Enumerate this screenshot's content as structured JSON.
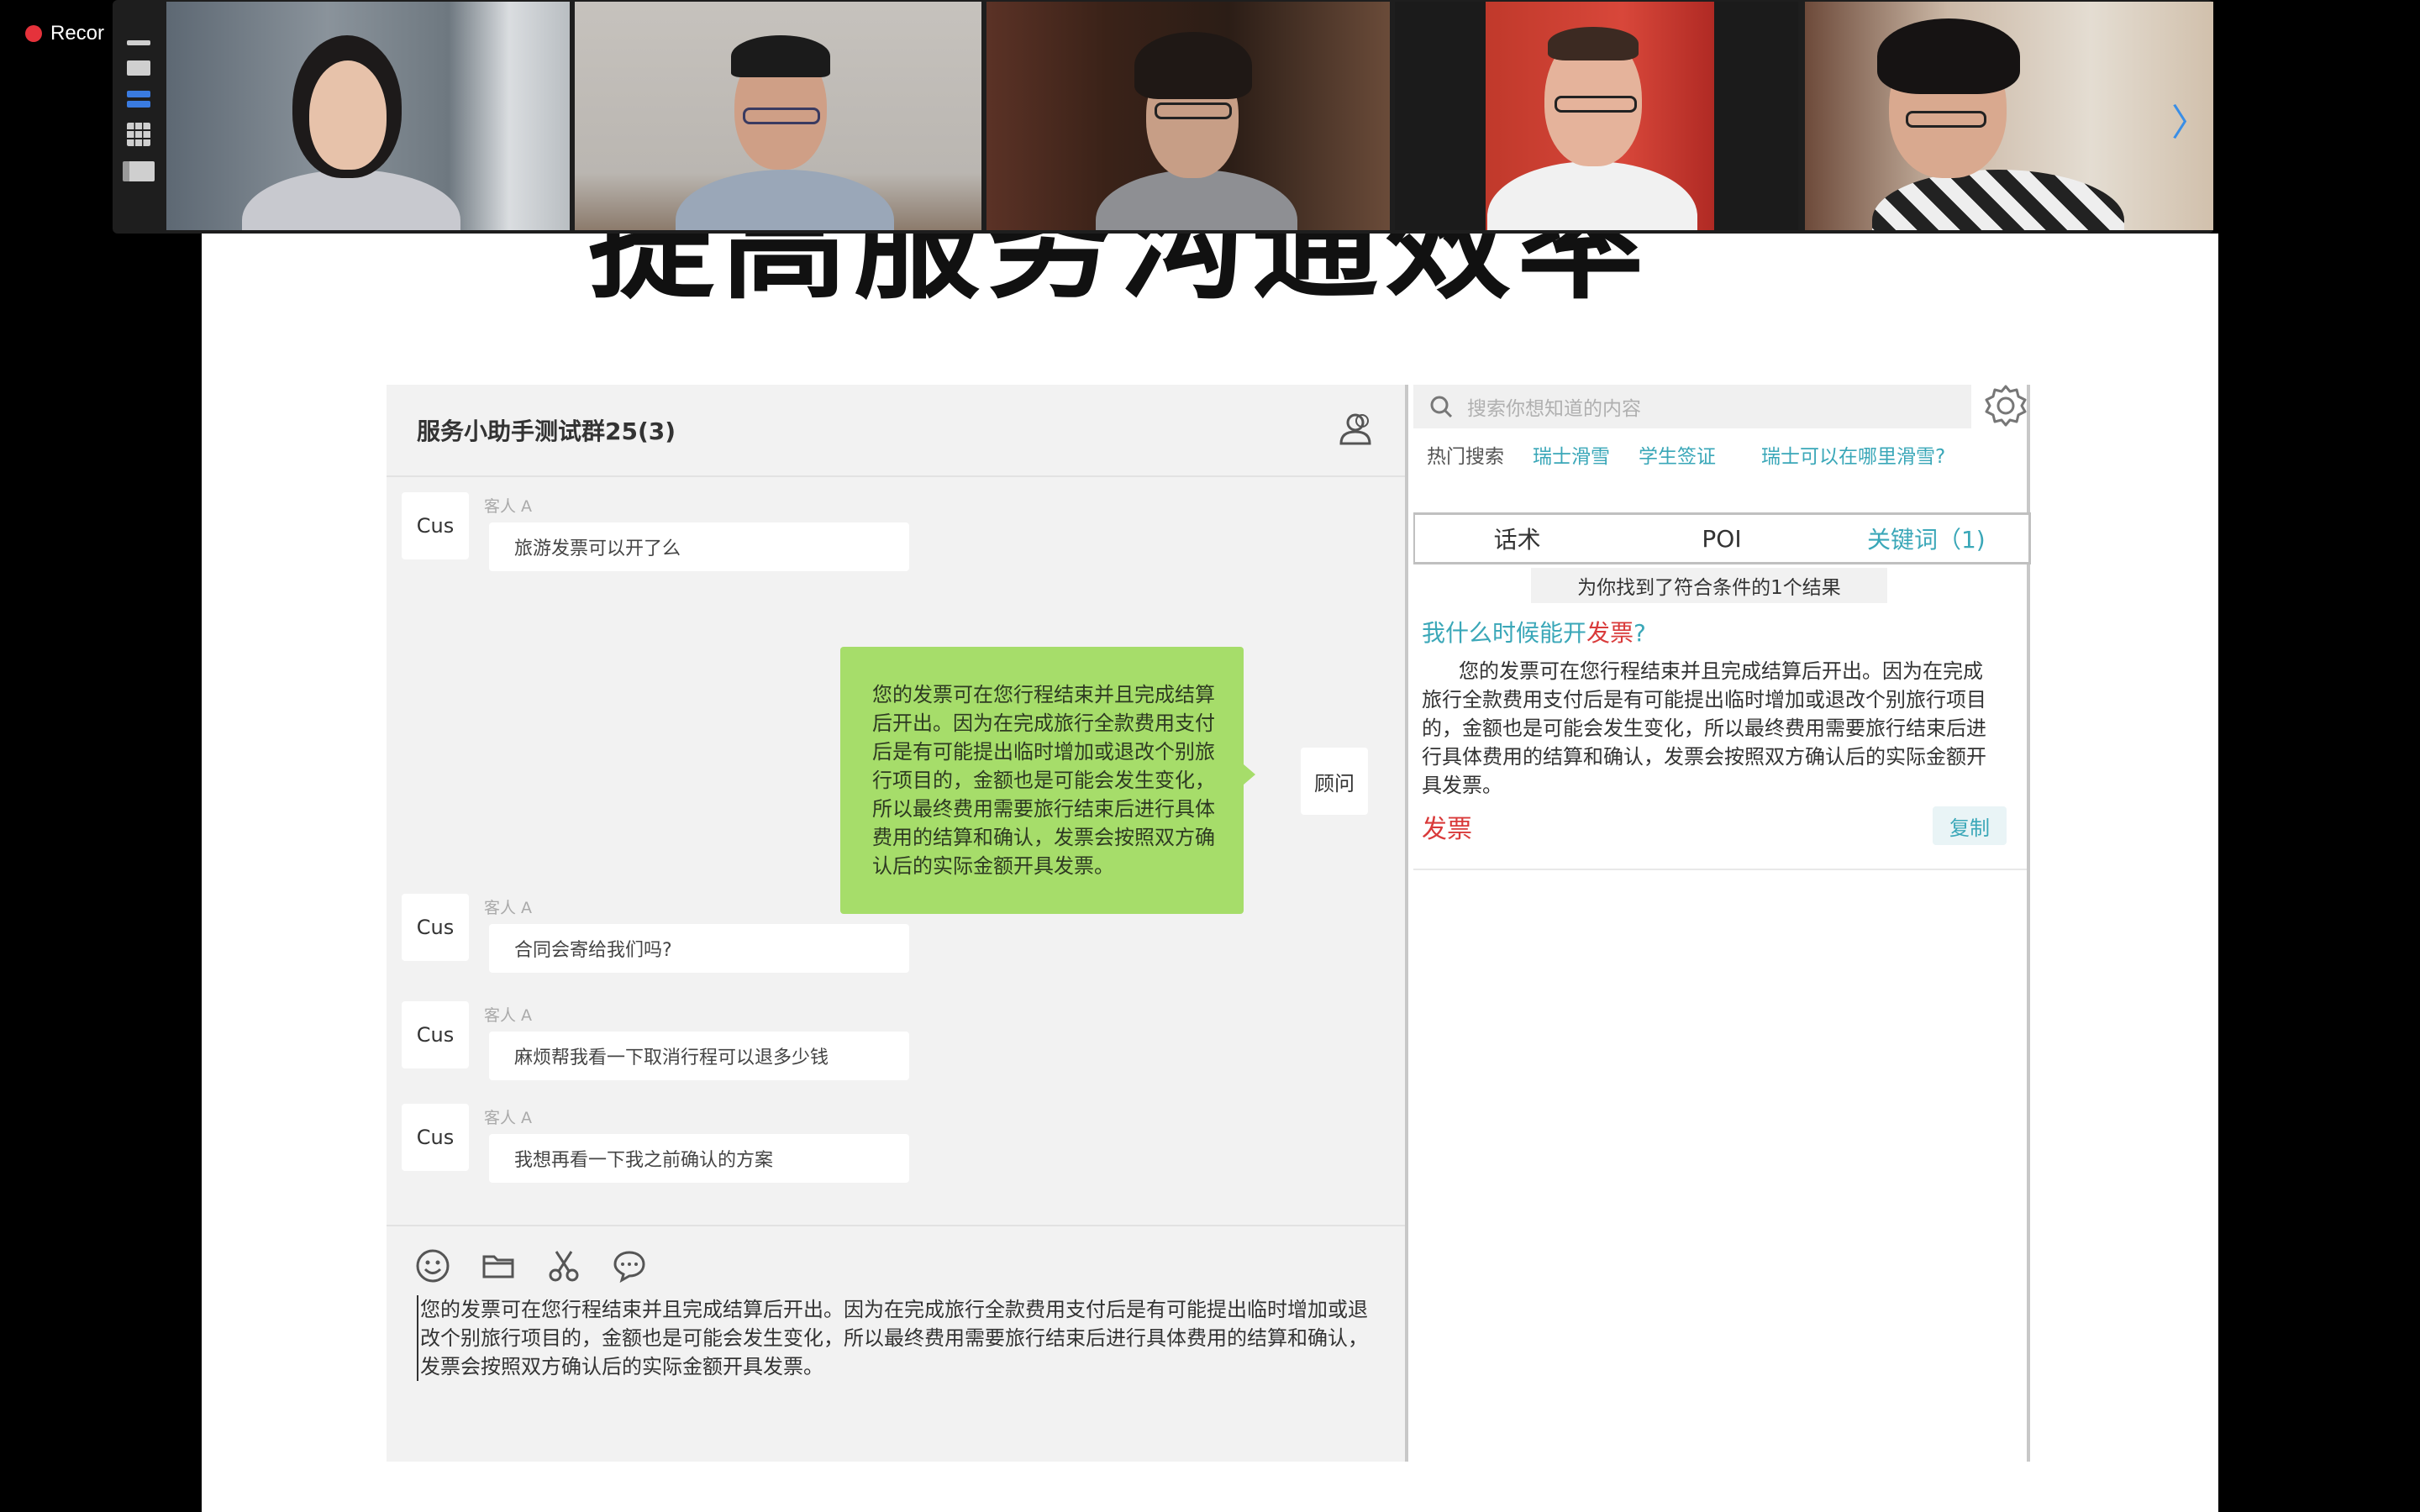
{
  "recording": {
    "label": "Recor"
  },
  "gallery": {
    "participants": [
      {
        "name": "participant-1"
      },
      {
        "name": "participant-2",
        "speaking": true
      },
      {
        "name": "participant-3"
      },
      {
        "name": "participant-4"
      },
      {
        "name": "participant-5"
      }
    ],
    "next_icon": "chevron-right-icon"
  },
  "slide": {
    "title": "提高服务沟通效率"
  },
  "chat": {
    "title": "服务小助手测试群25(3)",
    "messages": [
      {
        "avatar": "Cus",
        "sender": "客人 A",
        "text": "旅游发票可以开了么"
      },
      {
        "avatar": "顾问",
        "text": "您的发票可在您行程结束并且完成结算后开出。因为在完成旅行全款费用支付后是有可能提出临时增加或退改个别旅行项目的，金额也是可能会发生变化，所以最终费用需要旅行结束后进行具体费用的结算和确认，发票会按照双方确认后的实际金额开具发票。"
      },
      {
        "avatar": "Cus",
        "sender": "客人 A",
        "text": "合同会寄给我们吗?"
      },
      {
        "avatar": "Cus",
        "sender": "客人 A",
        "text": "麻烦帮我看一下取消行程可以退多少钱"
      },
      {
        "avatar": "Cus",
        "sender": "客人 A",
        "text": "我想再看一下我之前确认的方案"
      }
    ],
    "composer_text": "您的发票可在您行程结束并且完成结算后开出。因为在完成旅行全款费用支付后是有可能提出临时增加或退改个别旅行项目的，金额也是可能会发生变化，所以最终费用需要旅行结束后进行具体费用的结算和确认，发票会按照双方确认后的实际金额开具发票。"
  },
  "kb": {
    "search_placeholder": "搜索你想知道的内容",
    "hot_label": "热门搜索",
    "hot_tags": [
      "瑞士滑雪",
      "学生签证",
      "瑞士可以在哪里滑雪?"
    ],
    "tabs": [
      "话术",
      "POI",
      "关键词（1)"
    ],
    "result_count": "为你找到了符合条件的1个结果",
    "question_prefix": "我什么时候能开",
    "question_highlight": "发票",
    "question_suffix": "?",
    "answer": "您的发票可在您行程结束并且完成结算后开出。因为在完成旅行全款费用支付后是有可能提出临时增加或退改个别旅行项目的，金额也是可能会发生变化，所以最终费用需要旅行结束后进行具体费用的结算和确认，发票会按照双方确认后的实际金额开具发票。",
    "keyword": "发票",
    "copy_label": "复制"
  }
}
